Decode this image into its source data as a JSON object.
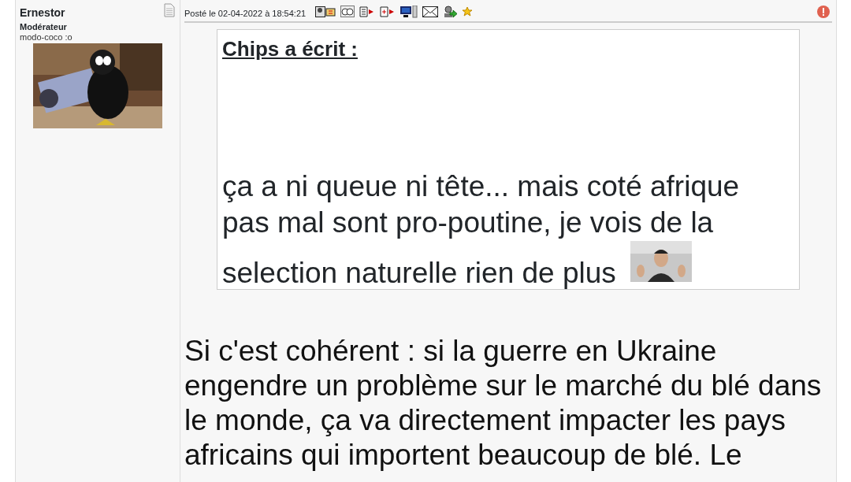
{
  "author": {
    "name": "Ernestor",
    "rank": "Modérateur",
    "title": "modo-coco :o",
    "avatar": {
      "kind": "picture"
    }
  },
  "post": {
    "posted": "Posté le 02-04-2022 à 18:54:21",
    "quote": {
      "heading": "Chips a écrit :",
      "lines": [
        "ça a ni queue ni tête... mais coté afrique",
        "pas mal sont pro-poutine, je vois de la",
        "selection naturelle rien de plus"
      ],
      "smiley": {
        "kind": "picture"
      }
    },
    "lines": [
      "Si c'est cohérent : si la guerre en Ukraine",
      "engendre un problème sur le marché du blé dans",
      "le monde, ça va directement impacter les pays",
      "africains qui importent beaucoup de blé. Le"
    ]
  }
}
